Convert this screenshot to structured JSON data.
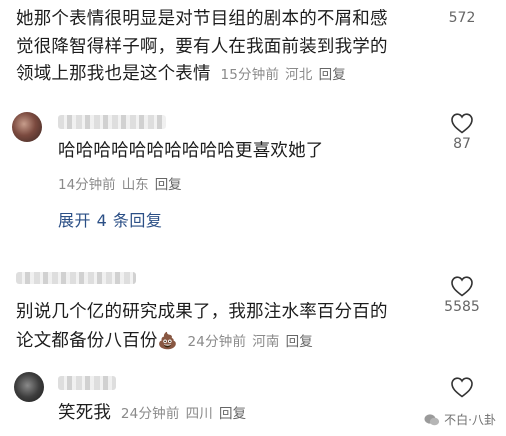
{
  "comments": [
    {
      "text_lines": [
        "她那个表情很明显是对节目组的剧本的不屑和感",
        "觉很降智得样子啊，要有人在我面前装到我学的",
        "领域上那我也是这个表情"
      ],
      "time": "15分钟前",
      "location": "河北",
      "reply": "回复",
      "likes": "572"
    },
    {
      "text": "哈哈哈哈哈哈哈哈哈哈更喜欢她了",
      "time": "14分钟前",
      "location": "山东",
      "reply": "回复",
      "likes": "87"
    },
    {
      "text_lines": [
        "别说几个亿的研究成果了，我那注水率百分百的",
        "论文都备份八百份"
      ],
      "emoji": "💩",
      "time": "24分钟前",
      "location": "河南",
      "reply": "回复",
      "likes": "5585"
    },
    {
      "text": "笑死我",
      "time": "24分钟前",
      "location": "四川",
      "reply": "回复",
      "likes": ""
    }
  ],
  "expand_label": "展开 4 条回复",
  "watermark": "不白·八卦",
  "colors": {
    "link": "#2b4f86",
    "meta": "#8a8a8a",
    "text": "#1d1d1d"
  },
  "icons": {
    "like": "heart-outline-icon",
    "expand": "chevron-down-icon",
    "watermark": "wechat-icon"
  }
}
